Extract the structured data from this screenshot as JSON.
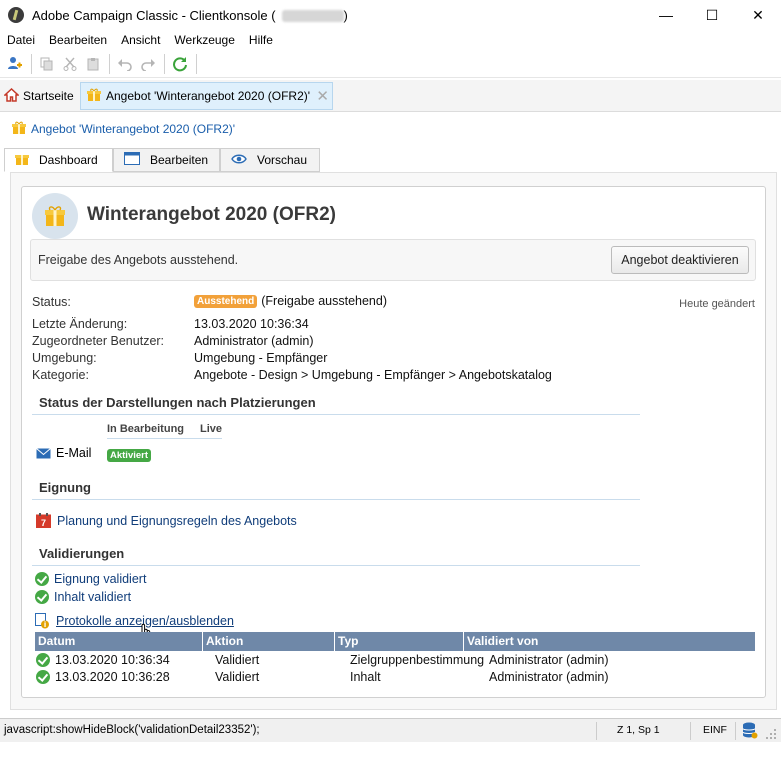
{
  "window": {
    "title": "Adobe Campaign Classic - Clientkonsole",
    "title_paren_open": "(",
    "title_paren_close": ")",
    "controls": {
      "minimize": "—",
      "maximize": "☐",
      "close": "✕"
    }
  },
  "menu": [
    "Datei",
    "Bearbeiten",
    "Ansicht",
    "Werkzeuge",
    "Hilfe"
  ],
  "tabs": {
    "home": "Startseite",
    "document": "Angebot 'Winterangebot 2020 (OFR2)'",
    "close": "✕"
  },
  "header": {
    "title": "Angebot 'Winterangebot 2020 (OFR2)'"
  },
  "content_tabs": [
    "Dashboard",
    "Bearbeiten",
    "Vorschau"
  ],
  "offer": {
    "title": "Winterangebot 2020 (OFR2)",
    "approval_message": "Freigabe des Angebots ausstehend.",
    "deactivate_button": "Angebot deaktivieren",
    "modified_note": "Heute geändert"
  },
  "info": {
    "status_label": "Status:",
    "status_badge": "Ausstehend",
    "status_text": "(Freigabe ausstehend)",
    "last_change_label": "Letzte Änderung:",
    "last_change_value": "13.03.2020 10:36:34",
    "assigned_user_label": "Zugeordneter Benutzer:",
    "assigned_user_value": "Administrator (admin)",
    "environment_label": "Umgebung:",
    "environment_value": "Umgebung - Empfänger",
    "category_label": "Kategorie:",
    "category_value": "Angebote - Design > Umgebung - Empfänger > Angebotskatalog"
  },
  "representations": {
    "section_title": "Status der Darstellungen nach Platzierungen",
    "col_editing": "In Bearbeitung",
    "col_live": "Live",
    "channel": "E-Mail",
    "channel_badge": "Aktiviert"
  },
  "eligibility": {
    "section_title": "Eignung",
    "link": "Planung und Eignungsregeln des Angebots",
    "calendar_day": "7"
  },
  "validations": {
    "section_title": "Validierungen",
    "items": [
      "Eignung validiert",
      "Inhalt validiert"
    ],
    "toggle_link": "Protokolle anzeigen/ausblenden",
    "columns": [
      "Datum",
      "Aktion",
      "Typ",
      "Validiert von"
    ],
    "rows": [
      {
        "date": "13.03.2020 10:36:34",
        "action": "Validiert",
        "type": "Zielgruppenbestimmung",
        "by": "Administrator (admin)"
      },
      {
        "date": "13.03.2020 10:36:28",
        "action": "Validiert",
        "type": "Inhalt",
        "by": "Administrator (admin)"
      }
    ]
  },
  "statusbar": {
    "url": "javascript:showHideBlock('validationDetail23352');",
    "position": "Z 1, Sp 1",
    "mode": "EINF"
  },
  "colors": {
    "link": "#103d7a",
    "pending_badge": "#f2a13a",
    "active_badge": "#45a845",
    "table_header": "#6f88a8"
  }
}
